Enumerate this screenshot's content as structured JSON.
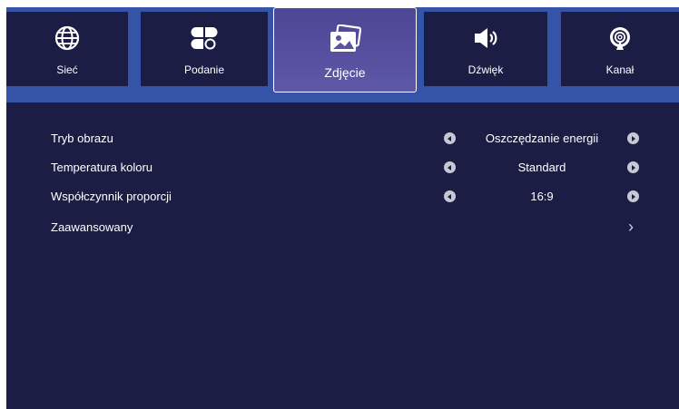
{
  "tabs": [
    {
      "label": "Sieć",
      "icon": "globe-icon",
      "active": false
    },
    {
      "label": "Podanie",
      "icon": "app-grid-icon",
      "active": false
    },
    {
      "label": "Zdjęcie",
      "icon": "picture-icon",
      "active": true
    },
    {
      "label": "Dźwięk",
      "icon": "speaker-icon",
      "active": false
    },
    {
      "label": "Kanał",
      "icon": "antenna-icon",
      "active": false
    }
  ],
  "settings": [
    {
      "label": "Tryb obrazu",
      "value": "Oszczędzanie energii"
    },
    {
      "label": "Temperatura koloru",
      "value": "Standard"
    },
    {
      "label": "Współczynnik proporcji",
      "value": "16:9"
    },
    {
      "label": "Zaawansowany",
      "value": ""
    }
  ],
  "colors": {
    "background": "#1b1d45",
    "top_bar": "#3554a8",
    "active_tab": "#5a53a3"
  }
}
